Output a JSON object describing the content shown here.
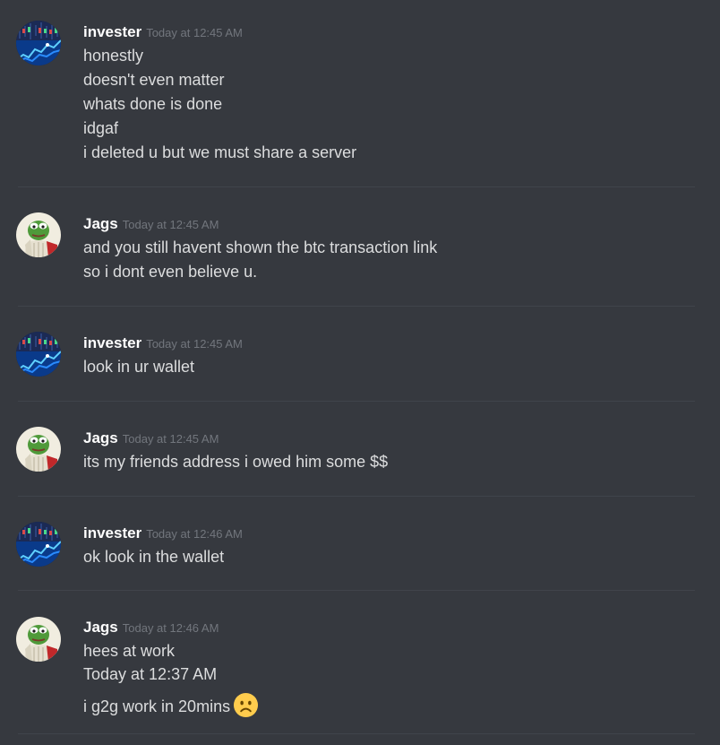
{
  "messages": [
    {
      "author": "invester",
      "timestamp": "Today at 12:45 AM",
      "avatar": "stock-chart-avatar",
      "lines": [
        "honestly",
        "doesn't even matter",
        "whats done is done",
        "idgaf",
        "i deleted u but we must share a server"
      ]
    },
    {
      "author": "Jags",
      "timestamp": "Today at 12:45 AM",
      "avatar": "pepe-frog-avatar",
      "lines": [
        "and you still havent shown the btc transaction link",
        "so i dont even believe u."
      ]
    },
    {
      "author": "invester",
      "timestamp": "Today at 12:45 AM",
      "avatar": "stock-chart-avatar",
      "lines": [
        "look in ur wallet"
      ]
    },
    {
      "author": "Jags",
      "timestamp": "Today at 12:45 AM",
      "avatar": "pepe-frog-avatar",
      "lines": [
        "its my friends address i owed him some $$"
      ]
    },
    {
      "author": "invester",
      "timestamp": "Today at 12:46 AM",
      "avatar": "stock-chart-avatar",
      "lines": [
        "ok look in the wallet"
      ]
    },
    {
      "author": "Jags",
      "timestamp": "Today at 12:46 AM",
      "avatar": "pepe-frog-avatar",
      "lines": [
        "hees at work",
        "Today at 12:37 AM",
        "i g2g work in 20mins"
      ],
      "trailing_emoji": "frowning-face-emoji"
    }
  ],
  "colors": {
    "background": "#36393f",
    "username": "#ffffff",
    "timestamp": "#72767d",
    "message_text": "#dcddde",
    "divider": "#40444b"
  }
}
